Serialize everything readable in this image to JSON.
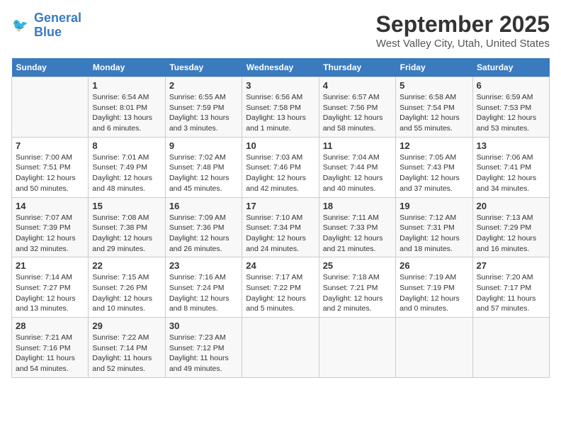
{
  "header": {
    "logo_line1": "General",
    "logo_line2": "Blue",
    "month": "September 2025",
    "location": "West Valley City, Utah, United States"
  },
  "days_of_week": [
    "Sunday",
    "Monday",
    "Tuesday",
    "Wednesday",
    "Thursday",
    "Friday",
    "Saturday"
  ],
  "weeks": [
    [
      {
        "day": "",
        "info": ""
      },
      {
        "day": "1",
        "info": "Sunrise: 6:54 AM\nSunset: 8:01 PM\nDaylight: 13 hours\nand 6 minutes."
      },
      {
        "day": "2",
        "info": "Sunrise: 6:55 AM\nSunset: 7:59 PM\nDaylight: 13 hours\nand 3 minutes."
      },
      {
        "day": "3",
        "info": "Sunrise: 6:56 AM\nSunset: 7:58 PM\nDaylight: 13 hours\nand 1 minute."
      },
      {
        "day": "4",
        "info": "Sunrise: 6:57 AM\nSunset: 7:56 PM\nDaylight: 12 hours\nand 58 minutes."
      },
      {
        "day": "5",
        "info": "Sunrise: 6:58 AM\nSunset: 7:54 PM\nDaylight: 12 hours\nand 55 minutes."
      },
      {
        "day": "6",
        "info": "Sunrise: 6:59 AM\nSunset: 7:53 PM\nDaylight: 12 hours\nand 53 minutes."
      }
    ],
    [
      {
        "day": "7",
        "info": "Sunrise: 7:00 AM\nSunset: 7:51 PM\nDaylight: 12 hours\nand 50 minutes."
      },
      {
        "day": "8",
        "info": "Sunrise: 7:01 AM\nSunset: 7:49 PM\nDaylight: 12 hours\nand 48 minutes."
      },
      {
        "day": "9",
        "info": "Sunrise: 7:02 AM\nSunset: 7:48 PM\nDaylight: 12 hours\nand 45 minutes."
      },
      {
        "day": "10",
        "info": "Sunrise: 7:03 AM\nSunset: 7:46 PM\nDaylight: 12 hours\nand 42 minutes."
      },
      {
        "day": "11",
        "info": "Sunrise: 7:04 AM\nSunset: 7:44 PM\nDaylight: 12 hours\nand 40 minutes."
      },
      {
        "day": "12",
        "info": "Sunrise: 7:05 AM\nSunset: 7:43 PM\nDaylight: 12 hours\nand 37 minutes."
      },
      {
        "day": "13",
        "info": "Sunrise: 7:06 AM\nSunset: 7:41 PM\nDaylight: 12 hours\nand 34 minutes."
      }
    ],
    [
      {
        "day": "14",
        "info": "Sunrise: 7:07 AM\nSunset: 7:39 PM\nDaylight: 12 hours\nand 32 minutes."
      },
      {
        "day": "15",
        "info": "Sunrise: 7:08 AM\nSunset: 7:38 PM\nDaylight: 12 hours\nand 29 minutes."
      },
      {
        "day": "16",
        "info": "Sunrise: 7:09 AM\nSunset: 7:36 PM\nDaylight: 12 hours\nand 26 minutes."
      },
      {
        "day": "17",
        "info": "Sunrise: 7:10 AM\nSunset: 7:34 PM\nDaylight: 12 hours\nand 24 minutes."
      },
      {
        "day": "18",
        "info": "Sunrise: 7:11 AM\nSunset: 7:33 PM\nDaylight: 12 hours\nand 21 minutes."
      },
      {
        "day": "19",
        "info": "Sunrise: 7:12 AM\nSunset: 7:31 PM\nDaylight: 12 hours\nand 18 minutes."
      },
      {
        "day": "20",
        "info": "Sunrise: 7:13 AM\nSunset: 7:29 PM\nDaylight: 12 hours\nand 16 minutes."
      }
    ],
    [
      {
        "day": "21",
        "info": "Sunrise: 7:14 AM\nSunset: 7:27 PM\nDaylight: 12 hours\nand 13 minutes."
      },
      {
        "day": "22",
        "info": "Sunrise: 7:15 AM\nSunset: 7:26 PM\nDaylight: 12 hours\nand 10 minutes."
      },
      {
        "day": "23",
        "info": "Sunrise: 7:16 AM\nSunset: 7:24 PM\nDaylight: 12 hours\nand 8 minutes."
      },
      {
        "day": "24",
        "info": "Sunrise: 7:17 AM\nSunset: 7:22 PM\nDaylight: 12 hours\nand 5 minutes."
      },
      {
        "day": "25",
        "info": "Sunrise: 7:18 AM\nSunset: 7:21 PM\nDaylight: 12 hours\nand 2 minutes."
      },
      {
        "day": "26",
        "info": "Sunrise: 7:19 AM\nSunset: 7:19 PM\nDaylight: 12 hours\nand 0 minutes."
      },
      {
        "day": "27",
        "info": "Sunrise: 7:20 AM\nSunset: 7:17 PM\nDaylight: 11 hours\nand 57 minutes."
      }
    ],
    [
      {
        "day": "28",
        "info": "Sunrise: 7:21 AM\nSunset: 7:16 PM\nDaylight: 11 hours\nand 54 minutes."
      },
      {
        "day": "29",
        "info": "Sunrise: 7:22 AM\nSunset: 7:14 PM\nDaylight: 11 hours\nand 52 minutes."
      },
      {
        "day": "30",
        "info": "Sunrise: 7:23 AM\nSunset: 7:12 PM\nDaylight: 11 hours\nand 49 minutes."
      },
      {
        "day": "",
        "info": ""
      },
      {
        "day": "",
        "info": ""
      },
      {
        "day": "",
        "info": ""
      },
      {
        "day": "",
        "info": ""
      }
    ]
  ]
}
